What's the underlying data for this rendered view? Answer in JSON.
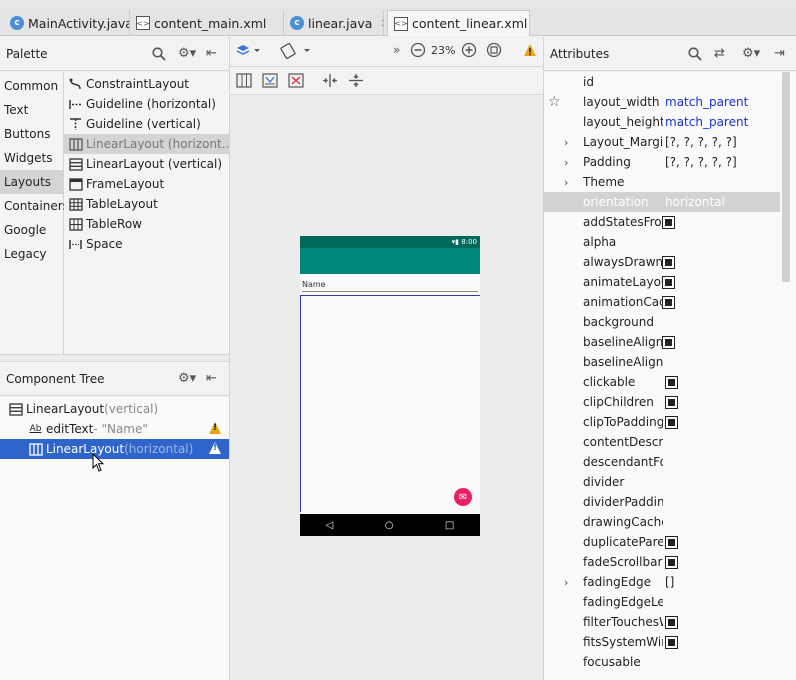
{
  "tabs": [
    {
      "label": "MainActivity.java",
      "icon": "java-class-icon"
    },
    {
      "label": "content_main.xml",
      "icon": "xml-icon"
    },
    {
      "label": "linear.java",
      "icon": "java-class-icon"
    },
    {
      "label": "content_linear.xml",
      "icon": "xml-icon",
      "active": true
    }
  ],
  "palette": {
    "title": "Palette",
    "categories": [
      "Common",
      "Text",
      "Buttons",
      "Widgets",
      "Layouts",
      "Containers",
      "Google",
      "Legacy"
    ],
    "selected_category": "Layouts",
    "items": [
      {
        "label": "ConstraintLayout",
        "icon": "constraint-layout-icon"
      },
      {
        "label": "Guideline (horizontal)",
        "icon": "guideline-horizontal-icon"
      },
      {
        "label": "Guideline (vertical)",
        "icon": "guideline-vertical-icon"
      },
      {
        "label": "LinearLayout (horizont...",
        "icon": "linear-layout-horizontal-icon",
        "selected": true
      },
      {
        "label": "LinearLayout (vertical)",
        "icon": "linear-layout-vertical-icon"
      },
      {
        "label": "FrameLayout",
        "icon": "frame-layout-icon"
      },
      {
        "label": "TableLayout",
        "icon": "table-layout-icon"
      },
      {
        "label": "TableRow",
        "icon": "table-row-icon"
      },
      {
        "label": "Space",
        "icon": "space-icon"
      }
    ]
  },
  "tree": {
    "title": "Component Tree",
    "rows": [
      {
        "name": "LinearLayout",
        "suffix": "(vertical)"
      },
      {
        "name": "editText",
        "suffix": "- \"Name\""
      },
      {
        "name": "LinearLayout",
        "suffix": "(horizontal)"
      }
    ]
  },
  "design": {
    "zoom": "23%",
    "device": {
      "time": "8:00",
      "field_hint": "Name"
    }
  },
  "attributes": {
    "title": "Attributes",
    "rows": [
      {
        "name": "id",
        "value": ""
      },
      {
        "name": "layout_width",
        "value": "match_parent"
      },
      {
        "name": "layout_height",
        "value": "match_parent"
      },
      {
        "name": "Layout_Margin",
        "value": "[?, ?, ?, ?, ?]"
      },
      {
        "name": "Padding",
        "value": "[?, ?, ?, ?, ?]"
      },
      {
        "name": "Theme",
        "value": ""
      },
      {
        "name": "orientation",
        "value": "horizontal"
      },
      {
        "name": "addStatesFrom",
        "value": ""
      },
      {
        "name": "alpha",
        "value": ""
      },
      {
        "name": "alwaysDrawnW",
        "value": ""
      },
      {
        "name": "animateLayout",
        "value": ""
      },
      {
        "name": "animationCach",
        "value": ""
      },
      {
        "name": "background",
        "value": ""
      },
      {
        "name": "baselineAligned",
        "value": ""
      },
      {
        "name": "baselineAligned",
        "value": ""
      },
      {
        "name": "clickable",
        "value": ""
      },
      {
        "name": "clipChildren",
        "value": ""
      },
      {
        "name": "clipToPadding",
        "value": ""
      },
      {
        "name": "contentDescrip",
        "value": ""
      },
      {
        "name": "descendantFoc",
        "value": ""
      },
      {
        "name": "divider",
        "value": ""
      },
      {
        "name": "dividerPadding",
        "value": ""
      },
      {
        "name": "drawingCacheQ",
        "value": ""
      },
      {
        "name": "duplicateParent",
        "value": ""
      },
      {
        "name": "fadeScrollbars",
        "value": ""
      },
      {
        "name": "fadingEdge",
        "value": "[]"
      },
      {
        "name": "fadingEdgeLen",
        "value": ""
      },
      {
        "name": "filterTouchesW",
        "value": ""
      },
      {
        "name": "fitsSystemWind",
        "value": ""
      },
      {
        "name": "focusable",
        "value": ""
      }
    ]
  },
  "colors": {
    "selection": "#2f65ca",
    "app_bar": "#00897b",
    "status_bar": "#00695c",
    "fab": "#e91e63",
    "warning": "#e8a317",
    "attr_link": "#1a33cc"
  }
}
